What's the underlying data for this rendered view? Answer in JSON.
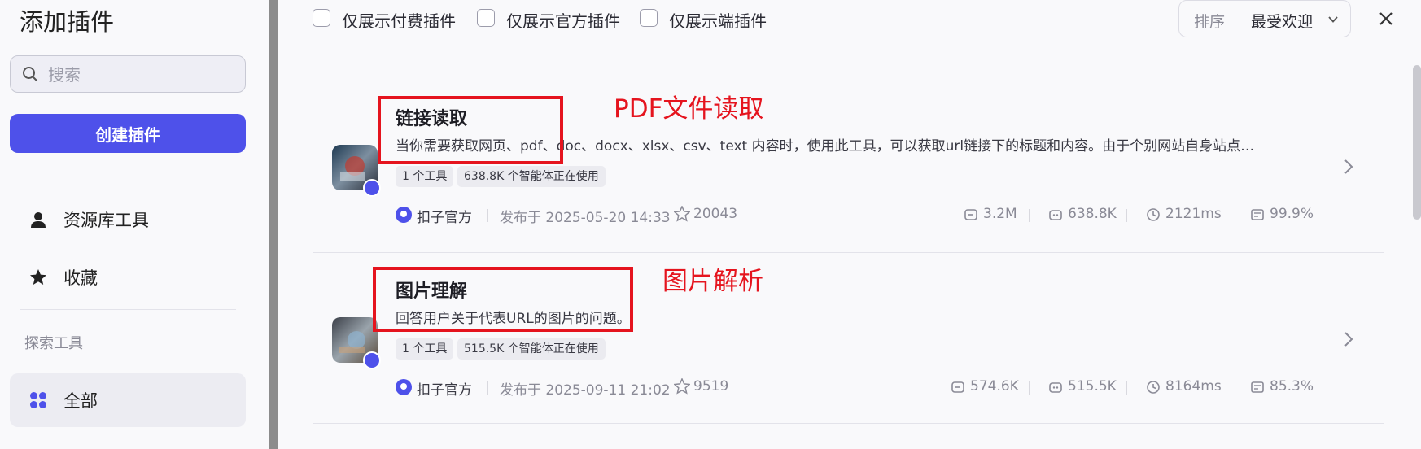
{
  "sidebar": {
    "title": "添加插件",
    "search_placeholder": "搜索",
    "create_button": "创建插件",
    "nav_items": [
      {
        "label": "资源库工具",
        "icon": "user-icon"
      },
      {
        "label": "收藏",
        "icon": "star-icon"
      }
    ],
    "explore_label": "探索工具",
    "active_item": {
      "label": "全部",
      "icon": "grid-icon"
    }
  },
  "filters": {
    "paid_only": "仅展示付费插件",
    "official_only": "仅展示官方插件",
    "client_only": "仅展示端插件",
    "sort_label": "排序",
    "sort_value": "最受欢迎"
  },
  "plugins": [
    {
      "title": "链接读取",
      "description": "当你需要获取网页、pdf、doc、docx、xlsx、csv、text 内容时，使用此工具，可以获取url链接下的标题和内容。由于个别网站自身站点…",
      "tools_tag": "1 个工具",
      "usage_tag": "638.8K 个智能体正在使用",
      "publisher": "扣子官方",
      "published": "发布于 2025-05-20 14:33",
      "favorites": "20043",
      "calls": "3.2M",
      "bots": "638.8K",
      "latency": "2121ms",
      "success_rate": "99.9%",
      "annotation": "PDF文件读取"
    },
    {
      "title": "图片理解",
      "description": "回答用户关于代表URL的图片的问题。",
      "tools_tag": "1 个工具",
      "usage_tag": "515.5K 个智能体正在使用",
      "publisher": "扣子官方",
      "published": "发布于 2025-09-11 21:02",
      "favorites": "9519",
      "calls": "574.6K",
      "bots": "515.5K",
      "latency": "8164ms",
      "success_rate": "85.3%",
      "annotation": "图片解析"
    }
  ],
  "third_row_title": "",
  "colors": {
    "accent": "#4e51ea",
    "annotation": "#e5141e"
  }
}
